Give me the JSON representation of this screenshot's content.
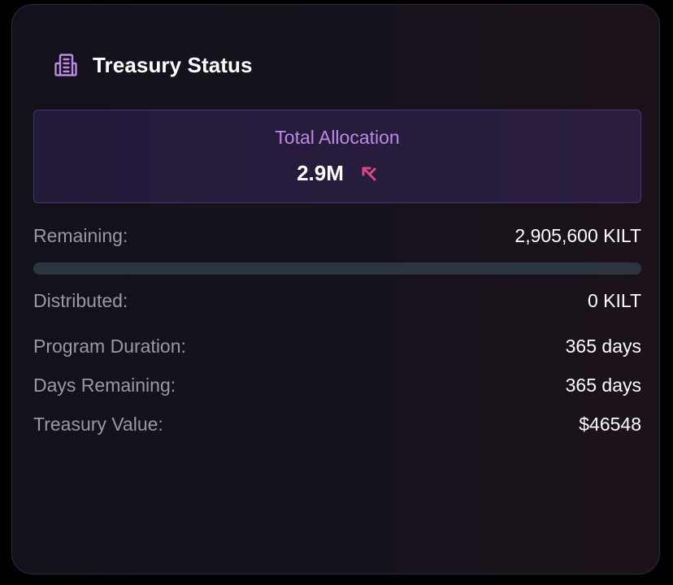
{
  "card": {
    "title": "Treasury Status",
    "icon": "building-icon"
  },
  "allocation": {
    "label": "Total Allocation",
    "value": "2.9M",
    "token_icon": "kilt-icon"
  },
  "remaining": {
    "label": "Remaining:",
    "value": "2,905,600 KILT",
    "progress_fraction": 0.0
  },
  "distributed": {
    "label": "Distributed:",
    "value": "0 KILT"
  },
  "program_duration": {
    "label": "Program Duration:",
    "value": "365 days"
  },
  "days_remaining": {
    "label": "Days Remaining:",
    "value": "365 days"
  },
  "treasury_value": {
    "label": "Treasury Value:",
    "value": "$46548"
  },
  "colors": {
    "accent_purple": "#b98ae8",
    "kilt_pink": "#d9487f",
    "muted_text": "#9a98a4",
    "track": "#2c3440"
  }
}
